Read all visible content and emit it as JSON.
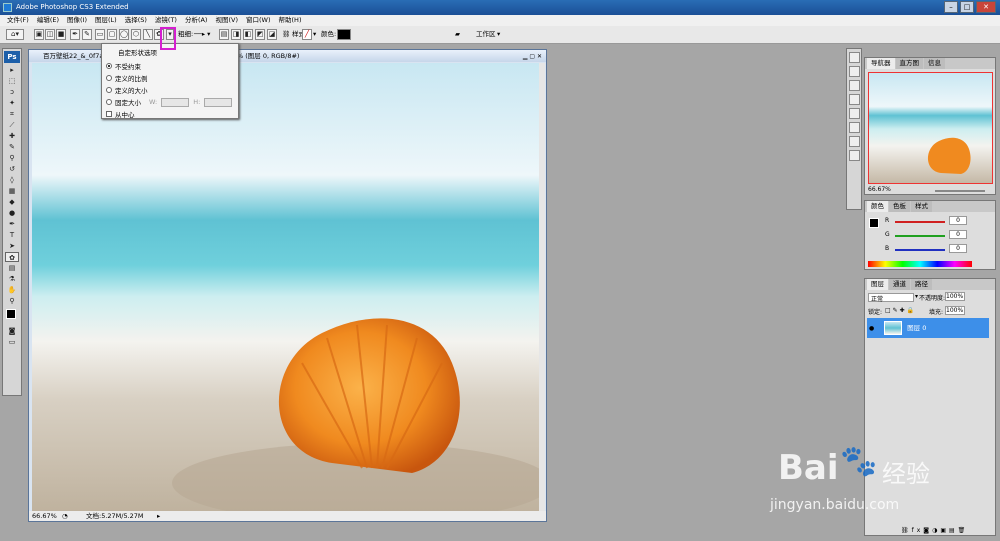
{
  "app": {
    "title": "Adobe Photoshop CS3 Extended"
  },
  "menu": [
    "文件(F)",
    "编辑(E)",
    "图像(I)",
    "图层(L)",
    "选择(S)",
    "滤镜(T)",
    "分析(A)",
    "视图(V)",
    "窗口(W)",
    "帮助(H)"
  ],
  "options_bar": {
    "arrow_label": "粗细:",
    "style_label": "样式:",
    "color_label": "颜色:",
    "workspace_label": "工作区"
  },
  "shape_options": {
    "title": "自定形状选项",
    "options": [
      "不受约束",
      "定义的比例",
      "定义的大小",
      "固定大小"
    ],
    "selected": "不受约束",
    "w_label": "W:",
    "h_label": "H:",
    "from_center": "从中心"
  },
  "document": {
    "title": "百万壁纸22_&_0f7a",
    "title_suffix": "% (图层 0, RGB/8#)",
    "zoom": "66.67%",
    "doc_size": "文档:5.27M/5.27M"
  },
  "navigator": {
    "tabs": [
      "导航器",
      "直方图",
      "信息"
    ],
    "zoom": "66.67%"
  },
  "color_panel": {
    "tabs": [
      "颜色",
      "色板",
      "样式"
    ],
    "channels": [
      {
        "label": "R",
        "value": "0",
        "color": "#d02020"
      },
      {
        "label": "G",
        "value": "0",
        "color": "#20a020"
      },
      {
        "label": "B",
        "value": "0",
        "color": "#2030c0"
      }
    ]
  },
  "layers_panel": {
    "tabs": [
      "图层",
      "通道",
      "路径"
    ],
    "blend_mode": "正常",
    "opacity_label": "不透明度:",
    "opacity": "100%",
    "lock_label": "锁定:",
    "fill_label": "填充:",
    "fill": "100%",
    "layers": [
      {
        "name": "图层 0"
      }
    ]
  },
  "watermark": {
    "brand": "Bai",
    "brand2": "经验",
    "url": "jingyan.baidu.com"
  },
  "colors": {
    "highlight": "#d51fd0",
    "selected_layer": "#3d8fe9"
  }
}
